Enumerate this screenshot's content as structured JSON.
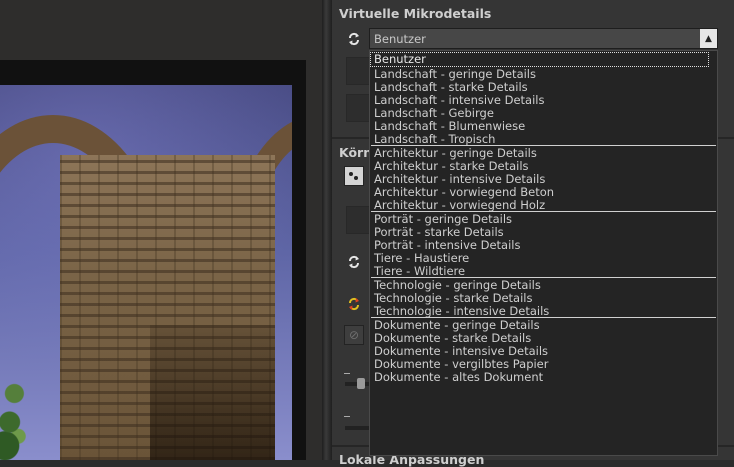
{
  "panel": {
    "section_title": "Virtuelle Mikrodetails",
    "second_section_title": "Körnung",
    "third_section_title": "Lokale Anpassungen"
  },
  "combo": {
    "value": "Benutzer"
  },
  "dropdown": {
    "options": [
      "Benutzer",
      "Landschaft - geringe Details",
      "Landschaft - starke Details",
      "Landschaft - intensive Details",
      "Landschaft - Gebirge",
      "Landschaft - Blumenwiese",
      "Landschaft - Tropisch",
      "Architektur - geringe Details",
      "Architektur - starke Details",
      "Architektur - intensive Details",
      "Architektur - vorwiegend Beton",
      "Architektur - vorwiegend Holz",
      "Porträt - geringe Details",
      "Porträt - starke Details",
      "Porträt - intensive Details",
      "Tiere - Haustiere",
      "Tiere - Wildtiere",
      "Technologie - geringe Details",
      "Technologie - starke Details",
      "Technologie - intensive Details",
      "Dokumente - geringe Details",
      "Dokumente - starke Details",
      "Dokumente - intensive Details",
      "Dokumente - vergilbtes Papier",
      "Dokumente - altes Dokument"
    ],
    "selected_index": 0
  },
  "icons": {
    "refresh": "refresh-icon",
    "dots": "dots-icon",
    "reset": "reset-icon",
    "disabled": "disabled-icon",
    "dropdown_arrow": "chevron-up-icon"
  },
  "colors": {
    "panel_bg": "#353535",
    "list_bg": "#242424",
    "highlight": "#e0c020"
  }
}
